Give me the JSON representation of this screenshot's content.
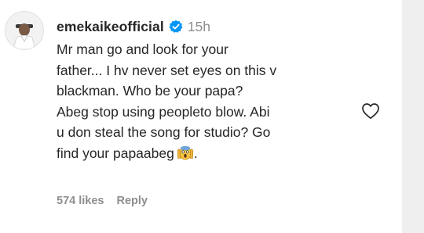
{
  "comment": {
    "username": "emekaikeofficial",
    "time": "15h",
    "text_lines": [
      "Mr man go and look for your",
      "father... I hv never set eyes on this v",
      "blackman. Who be your papa?",
      "Abeg stop using peopleto blow. Abi",
      "u don steal the song for studio? Go",
      "find your papaabeg"
    ],
    "trailing_punct": ".",
    "likes": "574 likes",
    "reply": "Reply",
    "emoji_icon": "face-screaming-in-fear-icon"
  },
  "icons": {
    "verified": "verified-badge-icon",
    "like": "heart-outline-icon"
  },
  "colors": {
    "verified": "#0095f6",
    "text": "#262626",
    "secondary": "#8e8e8e",
    "side_panel": "#efefef"
  }
}
